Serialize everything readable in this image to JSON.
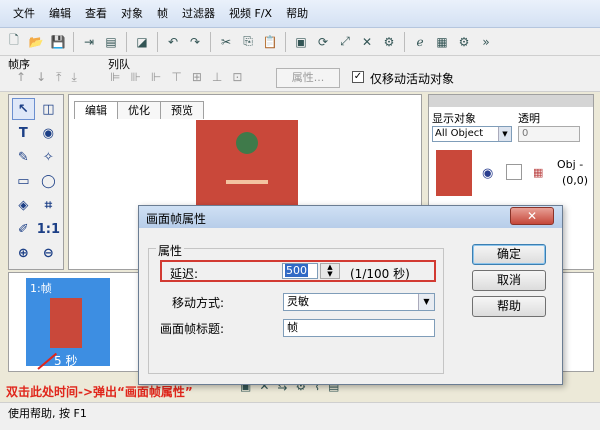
{
  "menu": [
    "文件",
    "编辑",
    "查看",
    "对象",
    "帧",
    "过滤器",
    "视频 F/X",
    "帮助"
  ],
  "toolbar2": {
    "order_label": "帧序",
    "queue_label": "列队",
    "attr_button": "属性...",
    "move_active_label": "仅移动活动对象",
    "move_active_checked": true
  },
  "canvas_tabs": [
    "编辑",
    "优化",
    "预览"
  ],
  "right_panel": {
    "display_label": "显示对象",
    "opacity_label": "透明",
    "display_select": "All Object",
    "opacity_value": "0",
    "obj_label": "Obj -",
    "obj_coords": "(0,0)"
  },
  "frame": {
    "label": "1:帧",
    "time": "5 秒"
  },
  "annotation": "双击此处时间->弹出“画面帧属性”",
  "statusbar": "使用帮助, 按 F1",
  "dialog": {
    "title": "画面帧属性",
    "group_label": "属性",
    "delay_label": "延迟:",
    "delay_value": "500",
    "delay_unit": "(1/100 秒)",
    "move_label": "移动方式:",
    "move_value": "灵敏",
    "title_label": "画面帧标题:",
    "title_value": "帧",
    "ok_button": "确定",
    "cancel_button": "取消",
    "help_button": "帮助"
  }
}
